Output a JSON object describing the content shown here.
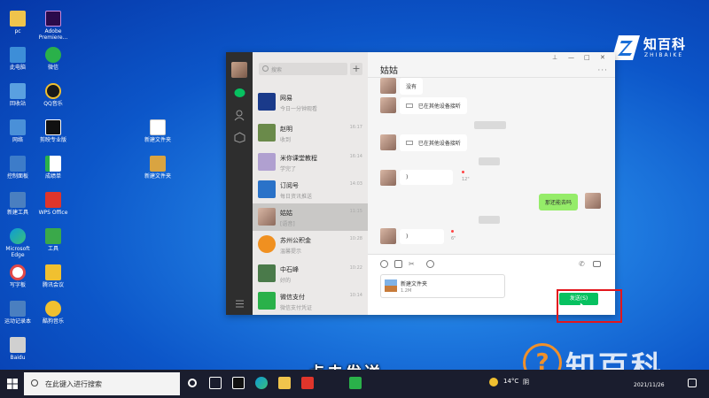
{
  "desktop": {
    "icons": [
      {
        "label": "pc",
        "color": "#f0c44c"
      },
      {
        "label": "Adobe Premiere...",
        "color": "#2a0a4a"
      },
      {
        "label": "此电脑",
        "color": "#3d8ed8"
      },
      {
        "label": "微信",
        "color": "#2ab14a"
      },
      {
        "label": "回收站",
        "color": "#5aa0e0"
      },
      {
        "label": "QQ音乐",
        "color": "#1a1a1a"
      },
      {
        "label": "网络",
        "color": "#4a90d8"
      },
      {
        "label": "剪映专业版",
        "color": "#111111"
      },
      {
        "label": "新建文件夹",
        "color": "#ffffff"
      },
      {
        "label": "控制面板",
        "color": "#3d7cc9"
      },
      {
        "label": "成绩单",
        "color": "#2ab14a"
      },
      {
        "label": "新建文件夹",
        "color": "#d9a441"
      },
      {
        "label": "新建工具",
        "color": "#4a7fc0"
      },
      {
        "label": "WPS Office",
        "color": "#e0352b"
      },
      {
        "label": "Microsoft Edge",
        "color": "#0d9ad6"
      },
      {
        "label": "工具",
        "color": "#3aa94a"
      },
      {
        "label": "写字板",
        "color": "#e04848"
      },
      {
        "label": "腾讯会议",
        "color": "#f0c030"
      },
      {
        "label": "运动记录本",
        "color": "#4a7fc0"
      },
      {
        "label": "酷狗音乐",
        "color": "#f0c030"
      },
      {
        "label": "Baidu",
        "color": "#d0d0d0"
      }
    ]
  },
  "logo": {
    "title": "知百科",
    "subtitle": "ZHIBAIKE"
  },
  "wechat": {
    "search_placeholder": "搜索",
    "plus": "+",
    "chats": [
      {
        "name": "网易",
        "msg": "今日一分钟观看",
        "time": "",
        "color": "#1a3a8a"
      },
      {
        "name": "赵明",
        "msg": "收到",
        "time": "16:17",
        "color": "#6a8a4a"
      },
      {
        "name": "米你课堂教程",
        "msg": "学完了",
        "time": "16:14",
        "color": "#b0a0d0"
      },
      {
        "name": "订阅号",
        "msg": "每日资讯推送",
        "time": "14:03",
        "color": "#2a72c8"
      },
      {
        "name": "姑姑",
        "msg": "[语音]",
        "time": "11:15",
        "color": "#c9a48c"
      },
      {
        "name": "苏州公积金",
        "msg": "温馨提示",
        "time": "10:28",
        "color": "#f09020"
      },
      {
        "name": "中石峰",
        "msg": "好的",
        "time": "10:22",
        "color": "#4a7a4a"
      },
      {
        "name": "微信支付",
        "msg": "微信支付凭证",
        "time": "10:14",
        "color": "#2ab14a"
      }
    ],
    "chat_title": "姑姑",
    "more": "···",
    "win": {
      "pin": "⊥",
      "min": "—",
      "max": "□",
      "close": "✕"
    },
    "messages": [
      {
        "kind": "text",
        "from": "her",
        "text": "没有"
      },
      {
        "kind": "call",
        "from": "her",
        "text": "已在其他设备接听"
      },
      {
        "kind": "call",
        "from": "her",
        "text": "已在其他设备接听"
      },
      {
        "kind": "voice",
        "from": "her",
        "text": "12\""
      },
      {
        "kind": "text",
        "from": "me",
        "text": "那还能去吗"
      },
      {
        "kind": "voice",
        "from": "her",
        "text": "6\""
      }
    ],
    "file": {
      "name": "新建文件夹",
      "size": "1.2M"
    },
    "send_label": "发送(S)"
  },
  "subtitle": "点击发送",
  "taskbar": {
    "search_placeholder": "在此键入进行搜索",
    "weather": "14°C",
    "weather_desc": "阴",
    "time": "",
    "date": "2021/11/26"
  },
  "watermark": {
    "symbol": "?",
    "text": "知百科"
  }
}
